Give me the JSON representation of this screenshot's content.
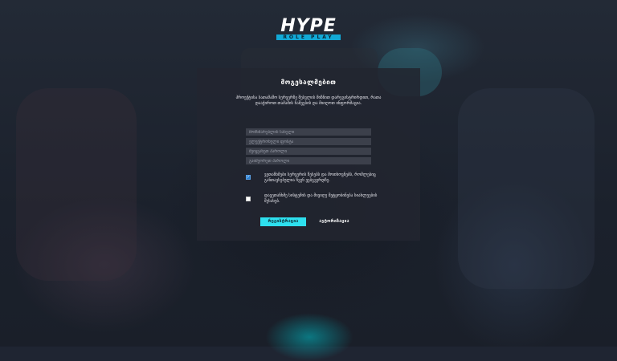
{
  "logo": {
    "word": "HYPE",
    "sub": "ROLE PLAY"
  },
  "dialog": {
    "title": "მოგესალმებით",
    "description": "პროექტისა სათამაშო სერვერზე შესვლის მიზნით დარეგისტრირდით, რათა დააჭიროთ თამაშის ჩაშვების და მიიღოთ ინფორმაცია."
  },
  "fields": [
    {
      "name": "username",
      "placeholder": "მომხმარებლის სახელი"
    },
    {
      "name": "email",
      "placeholder": "ელექტრონული ფოსტა"
    },
    {
      "name": "password",
      "placeholder": "შეიყვანეთ პაროლი"
    },
    {
      "name": "password_confirm",
      "placeholder": "გაიმეორეთ პაროლი"
    }
  ],
  "checkboxes": [
    {
      "checked": true,
      "text": "ვეთანხმები სერვერის წესებს და მოთხოვნებს, რომლებიც განთავსებულია ჩვენ ვებგვერდზე."
    },
    {
      "checked": false,
      "text": "დავეთანხმე სისტემის და მივიღე შეტყობინება სიახლეების შესახებ."
    }
  ],
  "buttons": {
    "register": "რეგისტრაცია",
    "login": "ავტორიზაცია"
  }
}
